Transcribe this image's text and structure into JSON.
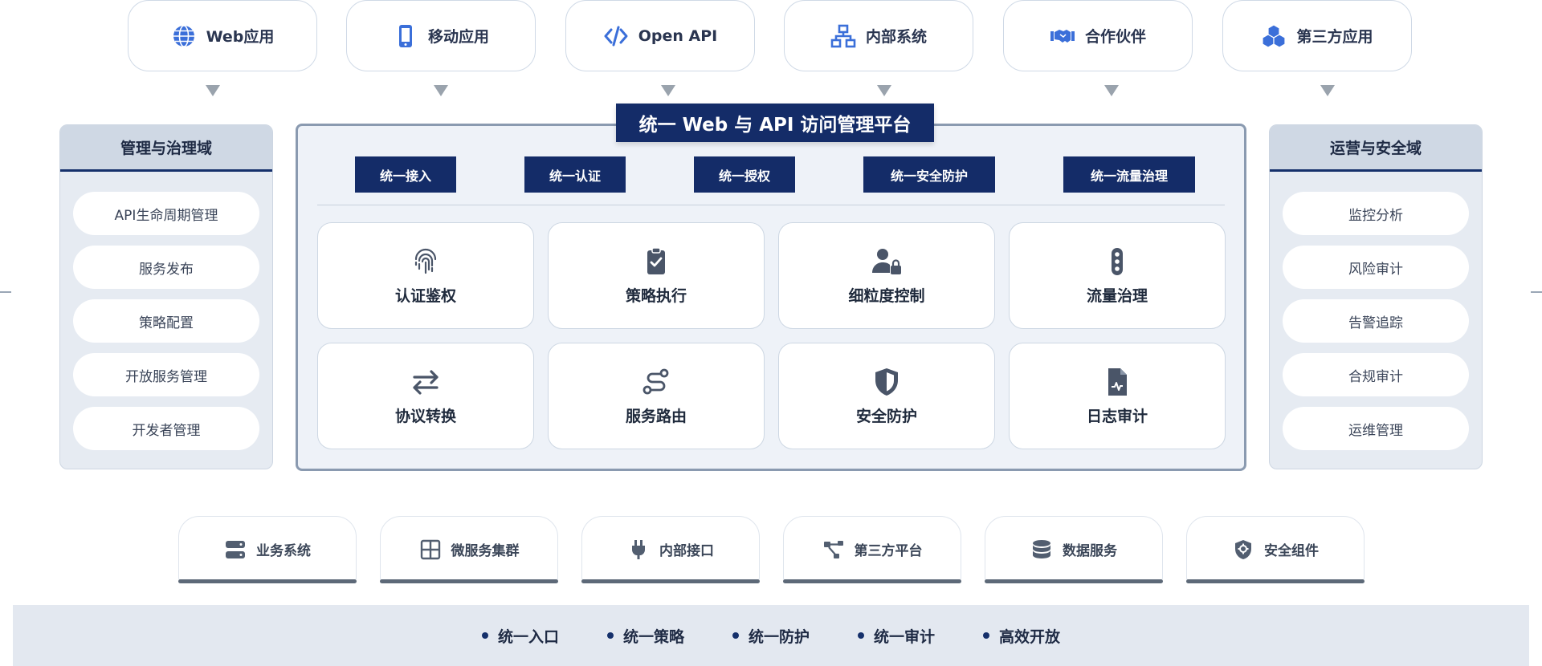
{
  "clients": [
    {
      "label": "Web应用",
      "icon": "globe-icon"
    },
    {
      "label": "移动应用",
      "icon": "mobile-icon"
    },
    {
      "label": "Open API",
      "icon": "code-icon"
    },
    {
      "label": "内部系统",
      "icon": "network-icon"
    },
    {
      "label": "合作伙伴",
      "icon": "handshake-icon"
    },
    {
      "label": "第三方应用",
      "icon": "cubes-icon"
    }
  ],
  "platform": {
    "title": "统一 Web 与 API 访问管理平台",
    "capabilities": [
      "统一接入",
      "统一认证",
      "统一授权",
      "统一安全防护",
      "统一流量治理"
    ],
    "functions": [
      {
        "label": "认证鉴权",
        "icon": "fingerprint-icon"
      },
      {
        "label": "策略执行",
        "icon": "clipboard-check-icon"
      },
      {
        "label": "细粒度控制",
        "icon": "user-lock-icon"
      },
      {
        "label": "流量治理",
        "icon": "traffic-light-icon"
      },
      {
        "label": "协议转换",
        "icon": "swap-arrows-icon"
      },
      {
        "label": "服务路由",
        "icon": "route-icon"
      },
      {
        "label": "安全防护",
        "icon": "shield-icon"
      },
      {
        "label": "日志审计",
        "icon": "log-file-icon"
      }
    ]
  },
  "left_panel": {
    "title": "管理与治理域",
    "items": [
      "API生命周期管理",
      "服务发布",
      "策略配置",
      "开放服务管理",
      "开发者管理"
    ]
  },
  "right_panel": {
    "title": "运营与安全域",
    "items": [
      "监控分析",
      "风险审计",
      "告警追踪",
      "合规审计",
      "运维管理"
    ]
  },
  "backends": [
    {
      "label": "业务系统",
      "icon": "server-icon"
    },
    {
      "label": "微服务集群",
      "icon": "grid-icon"
    },
    {
      "label": "内部接口",
      "icon": "plug-icon"
    },
    {
      "label": "第三方平台",
      "icon": "share-nodes-icon"
    },
    {
      "label": "数据服务",
      "icon": "database-icon"
    },
    {
      "label": "安全组件",
      "icon": "shield-gear-icon"
    }
  ],
  "footer": [
    "统一入口",
    "统一策略",
    "统一防护",
    "统一审计",
    "高效开放"
  ],
  "colors": {
    "navy": "#142c68",
    "blue_icon": "#3b6fd9",
    "slate_icon": "#4a5568"
  }
}
